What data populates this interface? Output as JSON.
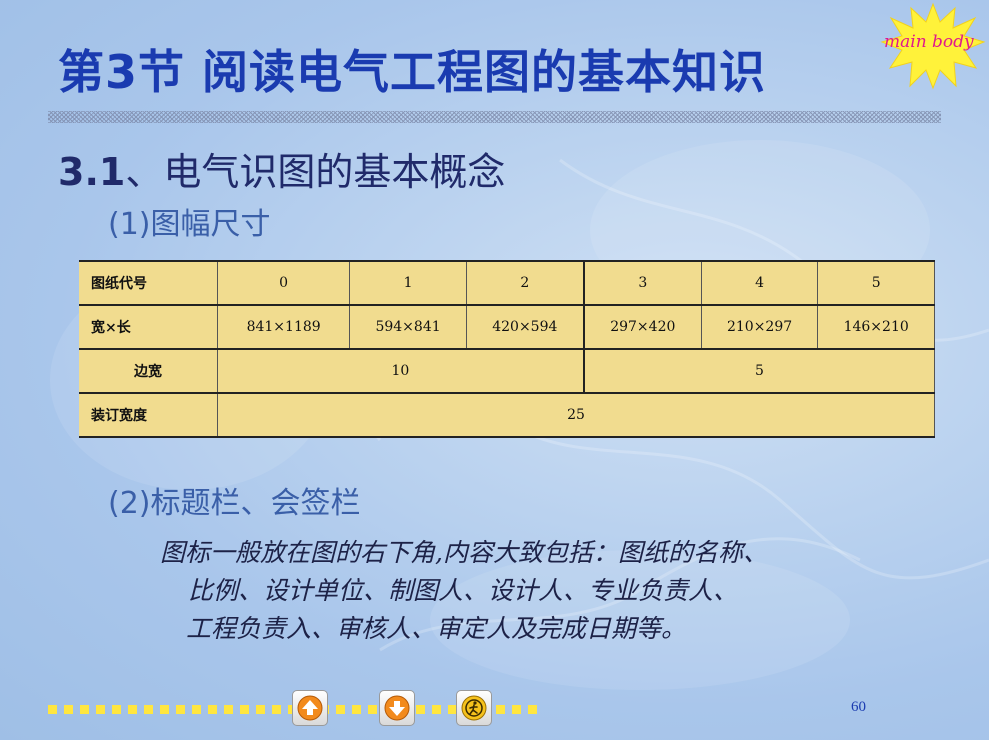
{
  "slide": {
    "title": "第3节  阅读电气工程图的基本知识",
    "badge_text": "main body",
    "section": {
      "number": "3.1",
      "text": "、电气识图的基本概念"
    },
    "subheading1": "(1)图幅尺寸",
    "table": {
      "row1": {
        "label": "图纸代号",
        "cells": [
          "0",
          "1",
          "2",
          "3",
          "4",
          "5"
        ]
      },
      "row2": {
        "label": "宽×长",
        "cells": [
          "841×1189",
          "594×841",
          "420×594",
          "297×420",
          "210×297",
          "146×210"
        ]
      },
      "row3": {
        "label": "边宽",
        "cells": [
          "10",
          "5"
        ]
      },
      "row4": {
        "label": "装订宽度",
        "cells": [
          "25"
        ]
      }
    },
    "subheading2": "(2)标题栏、会签栏",
    "paragraph": {
      "line1": "图标一般放在图的右下角,内容大致包括：图纸的名称、",
      "line2": "比例、设计单位、制图人、设计人、专业负责人、",
      "line3": "工程负责入、审核人、审定人及完成日期等。"
    },
    "navigation": {
      "home_icon": "home-arrow-icon",
      "next_icon": "down-arrow-icon",
      "exit_icon": "exit-runner-icon"
    },
    "page_number": "60",
    "colors": {
      "title": "#1a3bb0",
      "section": "#202a6a",
      "subheading": "#3a5fa8",
      "table_bg": "#f1dc8f",
      "badge_star": "#fff23a",
      "badge_text": "#e0198c",
      "dots": "#ffe640"
    }
  }
}
